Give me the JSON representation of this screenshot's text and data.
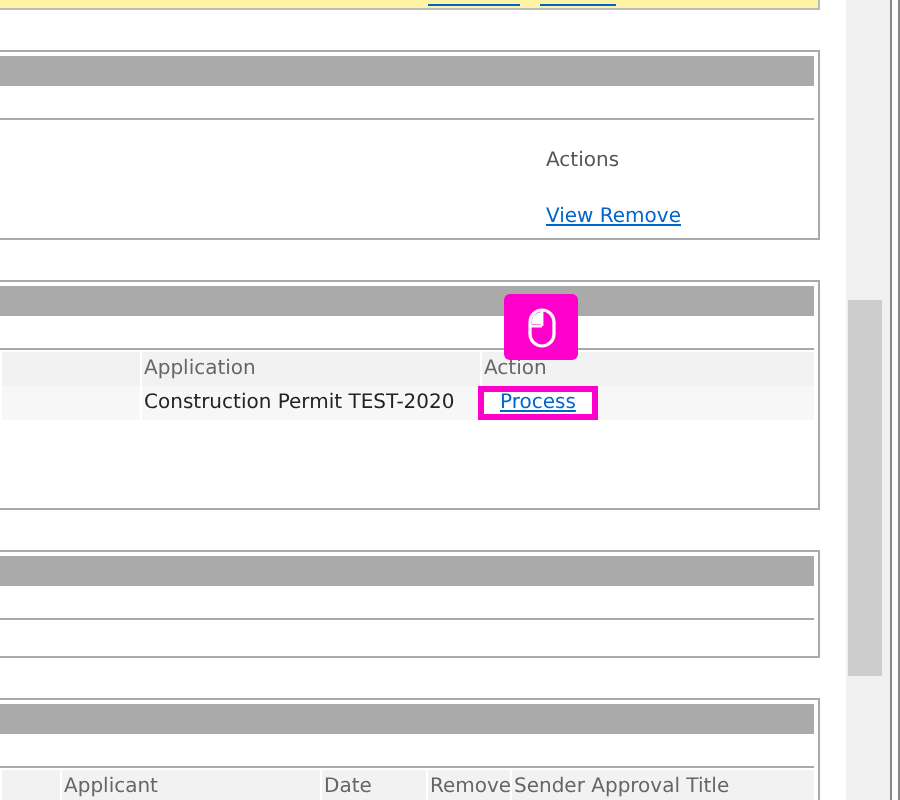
{
  "panels": [
    {
      "kind": "actions",
      "heading": "Actions",
      "link": "View Remove"
    },
    {
      "kind": "table",
      "columns": [
        {
          "label": "Application"
        },
        {
          "label": "Action"
        }
      ],
      "rows": [
        {
          "cells": [
            "Construction Permit TEST-2020"
          ],
          "action": {
            "label": "Process",
            "highlighted": true
          }
        }
      ]
    },
    {
      "kind": "empty"
    },
    {
      "kind": "table",
      "columns": [
        {
          "label": "Applicant"
        },
        {
          "label": "Date"
        },
        {
          "label": "Remove"
        },
        {
          "label": "Sender Approval Title"
        }
      ]
    }
  ]
}
